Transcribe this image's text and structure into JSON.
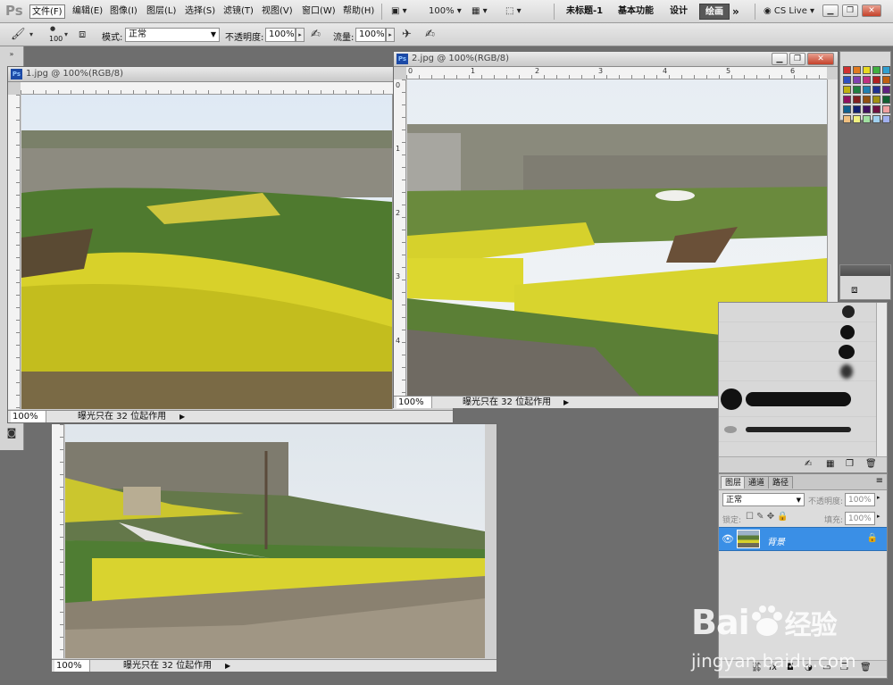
{
  "app": {
    "logo": "Ps"
  },
  "menubar": {
    "items": [
      {
        "label": "文件(F)"
      },
      {
        "label": "编辑(E)"
      },
      {
        "label": "图像(I)"
      },
      {
        "label": "图层(L)"
      },
      {
        "label": "选择(S)"
      },
      {
        "label": "滤镜(T)"
      },
      {
        "label": "视图(V)"
      },
      {
        "label": "窗口(W)"
      },
      {
        "label": "帮助(H)"
      }
    ],
    "zoom_value": "100%",
    "doc_name": "未标题-1",
    "workspaces": [
      "基本功能",
      "设计",
      "绘画"
    ],
    "active_workspace": "绘画",
    "more": "»",
    "cs_live": "CS Live"
  },
  "optionsbar": {
    "brush_size": "100",
    "mode_label": "模式:",
    "mode_value": "正常",
    "opacity_label": "不透明度:",
    "opacity_value": "100%",
    "flow_label": "流量:",
    "flow_value": "100%"
  },
  "documents": {
    "doc1": {
      "title": "1.jpg @ 100%(RGB/8)",
      "zoom": "100%",
      "status": "曝光只在 32 位起作用"
    },
    "doc2": {
      "title": "2.jpg @ 100%(RGB/8)",
      "zoom": "100%",
      "status": "曝光只在 32 位起作用",
      "ruler_h": [
        "0",
        "1",
        "2",
        "3",
        "4",
        "5",
        "6"
      ],
      "ruler_v": [
        "0",
        "1",
        "2",
        "3",
        "4"
      ]
    },
    "doc3": {
      "zoom": "100%",
      "status": "曝光只在 32 位起作用"
    }
  },
  "layers_panel": {
    "tabs": [
      "图层",
      "通道",
      "路径"
    ],
    "blend_mode": "正常",
    "opacity_label": "不透明度:",
    "opacity_value": "100%",
    "lock_label": "锁定:",
    "fill_label": "填充:",
    "fill_value": "100%",
    "layer_name": "背景"
  },
  "watermark": {
    "brand": "Bai",
    "brand_cn": "经验",
    "url": "jingyan.baidu.com"
  }
}
